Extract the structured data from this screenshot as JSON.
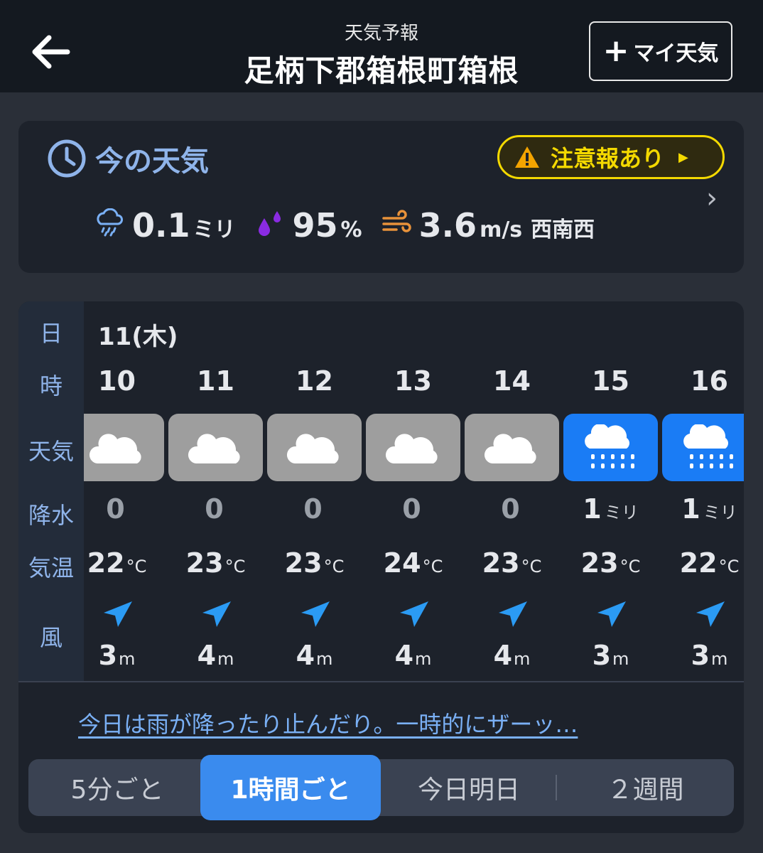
{
  "header": {
    "subtitle": "天気予報",
    "title": "足柄下郡箱根町箱根",
    "my_weather_label": "マイ天気"
  },
  "current": {
    "title": "今の天気",
    "alert_label": "注意報あり",
    "precip_value": "0.1",
    "precip_unit": "ミリ",
    "humidity_value": "95",
    "humidity_unit": "%",
    "wind_value": "3.6",
    "wind_unit": "m/s",
    "wind_direction": "西南西"
  },
  "forecast": {
    "labels": {
      "day": "日",
      "hour": "時",
      "weather": "天気",
      "precip": "降水",
      "temp": "気温",
      "wind": "風"
    },
    "date": "11(木)",
    "hours": [
      {
        "hour": "10",
        "weather": "cloudy-icon",
        "precip": "0",
        "precip_unit": "",
        "temp": "22",
        "temp_unit": "°C",
        "wind": "3",
        "wind_unit": "m"
      },
      {
        "hour": "11",
        "weather": "cloudy-icon",
        "precip": "0",
        "precip_unit": "",
        "temp": "23",
        "temp_unit": "°C",
        "wind": "4",
        "wind_unit": "m"
      },
      {
        "hour": "12",
        "weather": "cloudy-icon",
        "precip": "0",
        "precip_unit": "",
        "temp": "23",
        "temp_unit": "°C",
        "wind": "4",
        "wind_unit": "m"
      },
      {
        "hour": "13",
        "weather": "cloudy-icon",
        "precip": "0",
        "precip_unit": "",
        "temp": "24",
        "temp_unit": "°C",
        "wind": "4",
        "wind_unit": "m"
      },
      {
        "hour": "14",
        "weather": "cloudy-icon",
        "precip": "0",
        "precip_unit": "",
        "temp": "23",
        "temp_unit": "°C",
        "wind": "4",
        "wind_unit": "m"
      },
      {
        "hour": "15",
        "weather": "rain-icon",
        "precip": "1",
        "precip_unit": "ミリ",
        "temp": "23",
        "temp_unit": "°C",
        "wind": "3",
        "wind_unit": "m"
      },
      {
        "hour": "16",
        "weather": "rain-icon",
        "precip": "1",
        "precip_unit": "ミリ",
        "temp": "22",
        "temp_unit": "°C",
        "wind": "3",
        "wind_unit": "m"
      }
    ],
    "summary": "今日は雨が降ったり止んだり。一時的にザーッ…"
  },
  "tabs": [
    {
      "label": "5分ごと",
      "active": false
    },
    {
      "label": "1時間ごと",
      "active": true
    },
    {
      "label": "今日明日",
      "active": false
    },
    {
      "label": "２週間",
      "active": false
    }
  ],
  "colors": {
    "accent": "#3a8bee",
    "alert": "#f4d900",
    "rain_tile": "#1a7cf5",
    "cloud_tile": "#9e9e9e"
  }
}
